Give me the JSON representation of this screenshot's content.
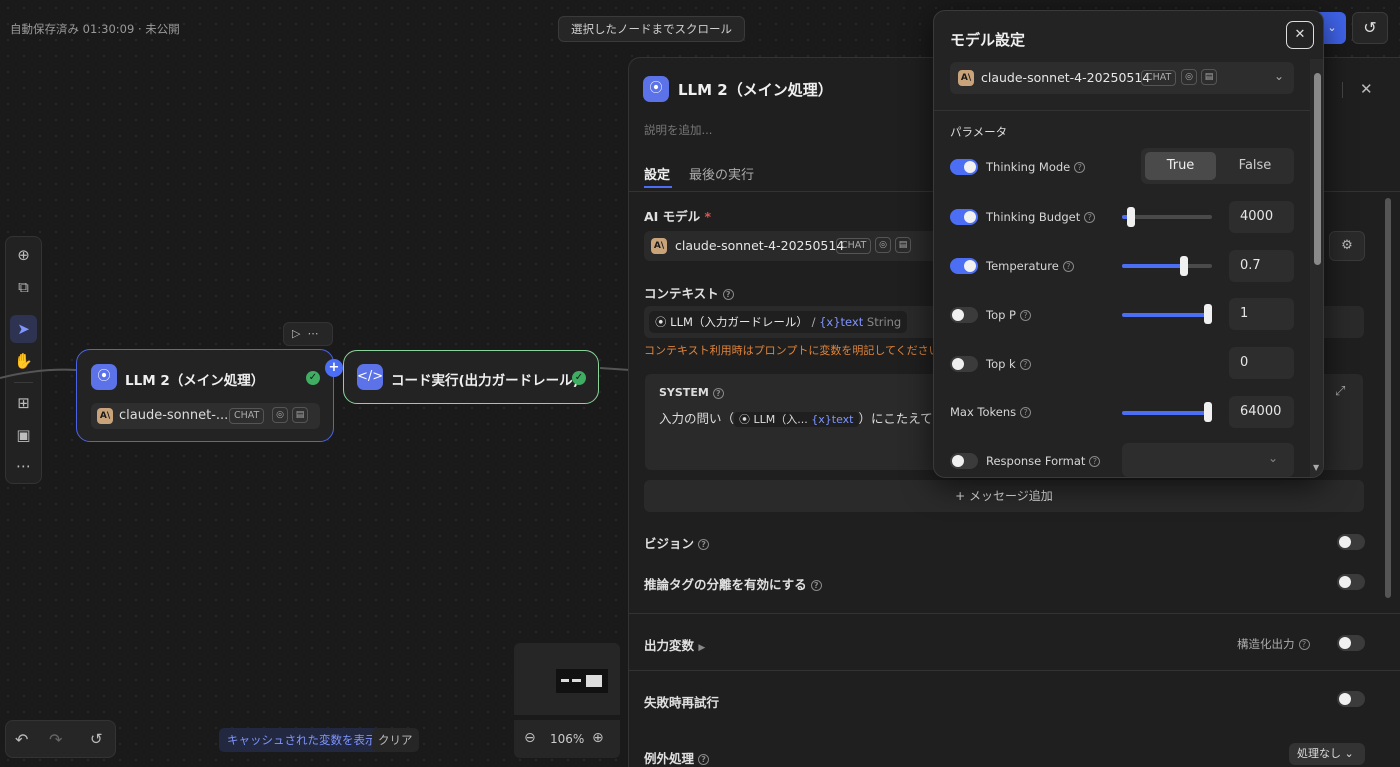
{
  "top": {
    "status": "自動保存済み 01:30:09 · 未公開",
    "scroll_button": "選択したノードまでスクロール"
  },
  "nodes": {
    "llm2": {
      "title": "LLM 2（メイン処理）",
      "model": "claude-sonnet-...",
      "tag": "CHAT"
    },
    "code": {
      "title": "コード実行(出力ガードレール)"
    }
  },
  "bottom": {
    "cached_vars": "キャッシュされた変数を表示",
    "clear": "クリア",
    "zoom": "106%"
  },
  "panel": {
    "title": "LLM 2（メイン処理）",
    "description_placeholder": "説明を追加...",
    "tabs": [
      {
        "label": "設定",
        "active": true
      },
      {
        "label": "最後の実行",
        "active": false
      }
    ],
    "ai_model_label": "AI モデル",
    "required_mark": "*",
    "model": {
      "name": "claude-sonnet-4-20250514",
      "tag": "CHAT"
    },
    "context_label": "コンテキスト",
    "context_var": {
      "node": "LLM（入力ガードレール）",
      "sep": "/",
      "var_symbol": "{x}",
      "var": "text",
      "type": "String"
    },
    "context_warning": "コンテキスト利用時はプロンプトに変数を明記してください",
    "system_label": "SYSTEM",
    "system_text_prefix": "入力の問い（",
    "system_var_node": "LLM（入...",
    "system_var_symbol": "{x}",
    "system_var": "text",
    "system_text_suffix": "）にこたえてくだ",
    "add_message": "メッセージ追加",
    "vision_label": "ビジョン",
    "reasoning_tag_label": "推論タグの分離を有効にする",
    "output_vars_label": "出力変数",
    "structured_output_label": "構造化出力",
    "retry_label": "失敗時再試行",
    "exception_label": "例外処理",
    "exception_value": "処理なし"
  },
  "popup": {
    "title": "モデル設定",
    "model": {
      "name": "claude-sonnet-4-20250514",
      "tag": "CHAT"
    },
    "params_label": "パラメータ",
    "thinking_mode": {
      "label": "Thinking Mode",
      "options": [
        "True",
        "False"
      ],
      "selected": "True",
      "enabled": true
    },
    "params": [
      {
        "label": "Thinking Budget",
        "value": "4000",
        "enabled": true,
        "slider": 0.1
      },
      {
        "label": "Temperature",
        "value": "0.7",
        "enabled": true,
        "slider": 0.7
      },
      {
        "label": "Top P",
        "value": "1",
        "enabled": false,
        "slider": 1.0
      },
      {
        "label": "Top k",
        "value": "0",
        "enabled": false,
        "slider": null
      },
      {
        "label": "Max Tokens",
        "value": "64000",
        "enabled": null,
        "slider": 1.0
      }
    ],
    "response_format": {
      "label": "Response Format",
      "enabled": false,
      "value": ""
    }
  },
  "colors": {
    "accent": "#4c6ef5",
    "success": "#3fae62",
    "warning": "#e0843a",
    "node_border": "#4c63e6",
    "code_node_border": "#8bd39a"
  }
}
